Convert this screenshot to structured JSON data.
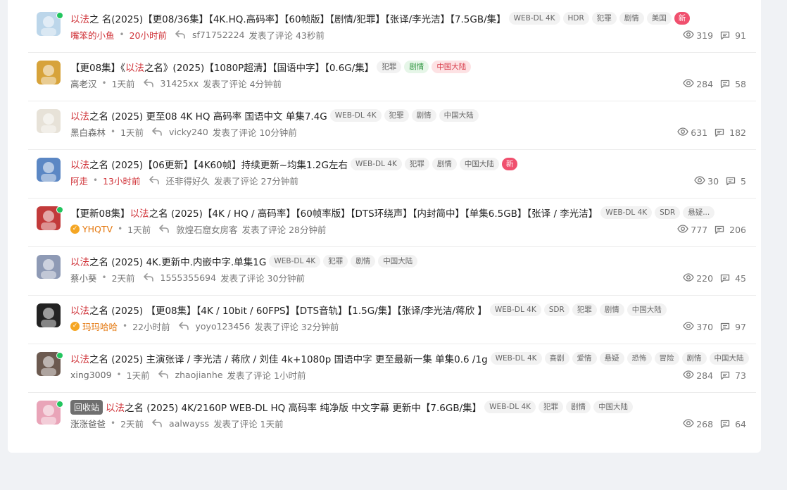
{
  "rows": [
    {
      "title_parts": [
        {
          "t": "以法",
          "hl": true
        },
        {
          "t": "之 名(2025)【更08/36集】【4K.HQ.高码率】【60帧版】【剧情/犯罪】【张译/李光洁】【7.5GB/集】",
          "hl": false
        }
      ],
      "recycle": "",
      "tags": [
        {
          "t": "WEB-DL 4K",
          "s": ""
        },
        {
          "t": "HDR",
          "s": ""
        },
        {
          "t": "犯罪",
          "s": ""
        },
        {
          "t": "剧情",
          "s": ""
        },
        {
          "t": "美国",
          "s": ""
        },
        {
          "t": "新",
          "s": "new"
        }
      ],
      "author": "嘴笨的小鱼",
      "author_style": "red",
      "verified": false,
      "time": "20小时前",
      "time_style": "red",
      "replier": "sf71752224",
      "reply_text": "发表了评论 43秒前",
      "views": "319",
      "comments": "91",
      "online": true
    },
    {
      "title_parts": [
        {
          "t": "【更08集】《",
          "hl": false
        },
        {
          "t": "以法",
          "hl": true
        },
        {
          "t": " 之名》(2025)【1080P超清】【国语中字】【0.6G/集】",
          "hl": false
        }
      ],
      "recycle": "",
      "tags": [
        {
          "t": "犯罪",
          "s": ""
        },
        {
          "t": "剧情",
          "s": "green"
        },
        {
          "t": "中国大陆",
          "s": "red"
        }
      ],
      "author": "高老汉",
      "author_style": "",
      "verified": false,
      "time": "1天前",
      "time_style": "",
      "replier": "31425xx",
      "reply_text": "发表了评论 4分钟前",
      "views": "284",
      "comments": "58",
      "online": false
    },
    {
      "title_parts": [
        {
          "t": "以法",
          "hl": true
        },
        {
          "t": " 之名 (2025) 更至08 4K HQ 高码率 国语中文 单集7.4G",
          "hl": false
        }
      ],
      "recycle": "",
      "tags": [
        {
          "t": "WEB-DL 4K",
          "s": ""
        },
        {
          "t": "犯罪",
          "s": ""
        },
        {
          "t": "剧情",
          "s": ""
        },
        {
          "t": "中国大陆",
          "s": ""
        }
      ],
      "author": "黑白森林",
      "author_style": "",
      "verified": false,
      "time": "1天前",
      "time_style": "",
      "replier": "vicky240",
      "reply_text": "发表了评论 10分钟前",
      "views": "631",
      "comments": "182",
      "online": false
    },
    {
      "title_parts": [
        {
          "t": "以法",
          "hl": true
        },
        {
          "t": " 之名 (2025)【06更新】【4K60帧】持续更新~均集1.2G左右",
          "hl": false
        }
      ],
      "recycle": "",
      "tags": [
        {
          "t": "WEB-DL 4K",
          "s": ""
        },
        {
          "t": "犯罪",
          "s": ""
        },
        {
          "t": "剧情",
          "s": ""
        },
        {
          "t": "中国大陆",
          "s": ""
        },
        {
          "t": "新",
          "s": "new"
        }
      ],
      "author": "阿走",
      "author_style": "red",
      "verified": false,
      "time": "13小时前",
      "time_style": "red",
      "replier": "还非得好久",
      "reply_text": "发表了评论 27分钟前",
      "views": "30",
      "comments": "5",
      "online": false
    },
    {
      "title_parts": [
        {
          "t": "【更新08集】",
          "hl": false
        },
        {
          "t": "以法",
          "hl": true
        },
        {
          "t": " 之名 (2025)【4K / HQ / 高码率】【60帧率版】【DTS环绕声】【内封简中】【单集6.5GB】【张译 / 李光洁】",
          "hl": false
        }
      ],
      "recycle": "",
      "tags": [
        {
          "t": "WEB-DL 4K",
          "s": ""
        },
        {
          "t": "SDR",
          "s": ""
        },
        {
          "t": "悬疑...",
          "s": ""
        }
      ],
      "author": "YHQTV",
      "author_style": "orange",
      "verified": true,
      "time": "1天前",
      "time_style": "",
      "replier": "敦煌石窟女房客",
      "reply_text": "发表了评论 28分钟前",
      "views": "777",
      "comments": "206",
      "online": true
    },
    {
      "title_parts": [
        {
          "t": "以法",
          "hl": true
        },
        {
          "t": " 之名 (2025) 4K.更新中.内嵌中字.单集1G",
          "hl": false
        }
      ],
      "recycle": "",
      "tags": [
        {
          "t": "WEB-DL 4K",
          "s": ""
        },
        {
          "t": "犯罪",
          "s": ""
        },
        {
          "t": "剧情",
          "s": ""
        },
        {
          "t": "中国大陆",
          "s": ""
        }
      ],
      "author": "蔡小葵",
      "author_style": "",
      "verified": false,
      "time": "2天前",
      "time_style": "",
      "replier": "1555355694",
      "reply_text": "发表了评论 30分钟前",
      "views": "220",
      "comments": "45",
      "online": false
    },
    {
      "title_parts": [
        {
          "t": "以法",
          "hl": true
        },
        {
          "t": " 之名 (2025) 【更08集】【4K / 10bit / 60FPS】【DTS音轨】【1.5G/集】【张译/李光洁/蒋欣 】",
          "hl": false
        }
      ],
      "recycle": "",
      "tags": [
        {
          "t": "WEB-DL 4K",
          "s": ""
        },
        {
          "t": "SDR",
          "s": ""
        },
        {
          "t": "犯罪",
          "s": ""
        },
        {
          "t": "剧情",
          "s": ""
        },
        {
          "t": "中国大陆",
          "s": ""
        }
      ],
      "author": "玛玛哈哈",
      "author_style": "orange",
      "verified": true,
      "time": "22小时前",
      "time_style": "",
      "replier": "yoyo123456",
      "reply_text": "发表了评论 32分钟前",
      "views": "370",
      "comments": "97",
      "online": false
    },
    {
      "title_parts": [
        {
          "t": "以法",
          "hl": true
        },
        {
          "t": " 之名 (2025) 主演张译 / 李光洁 / 蒋欣 / 刘佳 4k+1080p 国语中字 更至最新一集 单集0.6 /1g",
          "hl": false
        }
      ],
      "recycle": "",
      "tags": [
        {
          "t": "WEB-DL 4K",
          "s": ""
        },
        {
          "t": "喜剧",
          "s": ""
        },
        {
          "t": "爱情",
          "s": ""
        },
        {
          "t": "悬疑",
          "s": ""
        },
        {
          "t": "恐怖",
          "s": ""
        },
        {
          "t": "冒险",
          "s": ""
        },
        {
          "t": "剧情",
          "s": ""
        },
        {
          "t": "中国大陆",
          "s": ""
        }
      ],
      "author": "xing3009",
      "author_style": "",
      "verified": false,
      "time": "1天前",
      "time_style": "",
      "replier": "zhaojianhe",
      "reply_text": "发表了评论 1小时前",
      "views": "284",
      "comments": "73",
      "online": true
    },
    {
      "title_parts": [
        {
          "t": "以法",
          "hl": true
        },
        {
          "t": "之名 (2025) 4K/2160P WEB-DL HQ 高码率 纯净版 中文字幕 更新中【7.6GB/集】",
          "hl": false
        }
      ],
      "recycle": "回收站",
      "tags": [
        {
          "t": "WEB-DL 4K",
          "s": ""
        },
        {
          "t": "犯罪",
          "s": ""
        },
        {
          "t": "剧情",
          "s": ""
        },
        {
          "t": "中国大陆",
          "s": ""
        }
      ],
      "author": "涨涨爸爸",
      "author_style": "",
      "verified": false,
      "time": "2天前",
      "time_style": "",
      "replier": "aalwayss",
      "reply_text": "发表了评论 1天前",
      "views": "268",
      "comments": "64",
      "online": true
    }
  ],
  "avatar_colors": [
    "#bcd6ea",
    "#d7a33a",
    "#e7e2d8",
    "#5b87c4",
    "#c23a3a",
    "#8e9ab5",
    "#222222",
    "#6c5a50",
    "#e9a4b8"
  ],
  "icons": {
    "reply": "reply-arrow-icon",
    "views": "eye-icon",
    "comments": "comment-icon",
    "verified": "checkmark-badge-icon"
  }
}
